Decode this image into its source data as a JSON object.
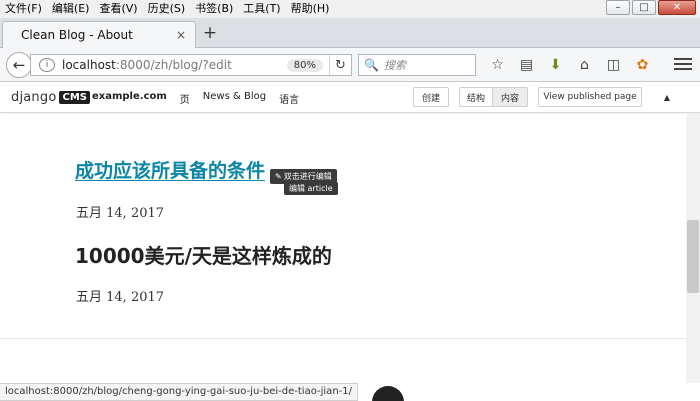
{
  "menubar": {
    "items": [
      "文件(F)",
      "编辑(E)",
      "查看(V)",
      "历史(S)",
      "书签(B)",
      "工具(T)",
      "帮助(H)"
    ]
  },
  "window_controls": {
    "minimize": "–",
    "maximize": "□",
    "close": "✕"
  },
  "tabs": [
    {
      "title": "Clean Blog - About",
      "close": "×"
    }
  ],
  "new_tab": "+",
  "navbar": {
    "back": "←",
    "info": "i",
    "url_host": "localhost",
    "url_path": ":8000/zh/blog/?edit",
    "zoom": "80%",
    "reload": "↻",
    "search_placeholder": "搜索",
    "search_icon": "🔍"
  },
  "toolbar_icons": [
    {
      "name": "bookmark-star-icon",
      "glyph": "☆"
    },
    {
      "name": "reading-list-icon",
      "glyph": "▤"
    },
    {
      "name": "download-icon",
      "glyph": "⬇"
    },
    {
      "name": "home-icon",
      "glyph": "⌂"
    },
    {
      "name": "pocket-icon",
      "glyph": "◫"
    },
    {
      "name": "extension-icon",
      "glyph": "✿"
    }
  ],
  "cms": {
    "logo_text": "django",
    "logo_badge": "CMS",
    "menu": [
      "example.com",
      "页",
      "News & Blog",
      "语言"
    ],
    "create_label": "创建",
    "structure_label": "结构",
    "content_label": "内容",
    "view_published_label": "View published page",
    "collapse_icon": "▲"
  },
  "posts": [
    {
      "title": "成功应该所具备的条件",
      "date": "五月 14, 2017"
    },
    {
      "title": "10000美元/天是这样炼成的",
      "date": "五月 14, 2017"
    }
  ],
  "tooltip": {
    "pen": "✎",
    "line1": "双击进行编辑",
    "line2": "编辑 article"
  },
  "statusbar": {
    "url": "localhost:8000/zh/blog/cheng-gong-ying-gai-suo-ju-bei-de-tiao-jian-1/"
  }
}
